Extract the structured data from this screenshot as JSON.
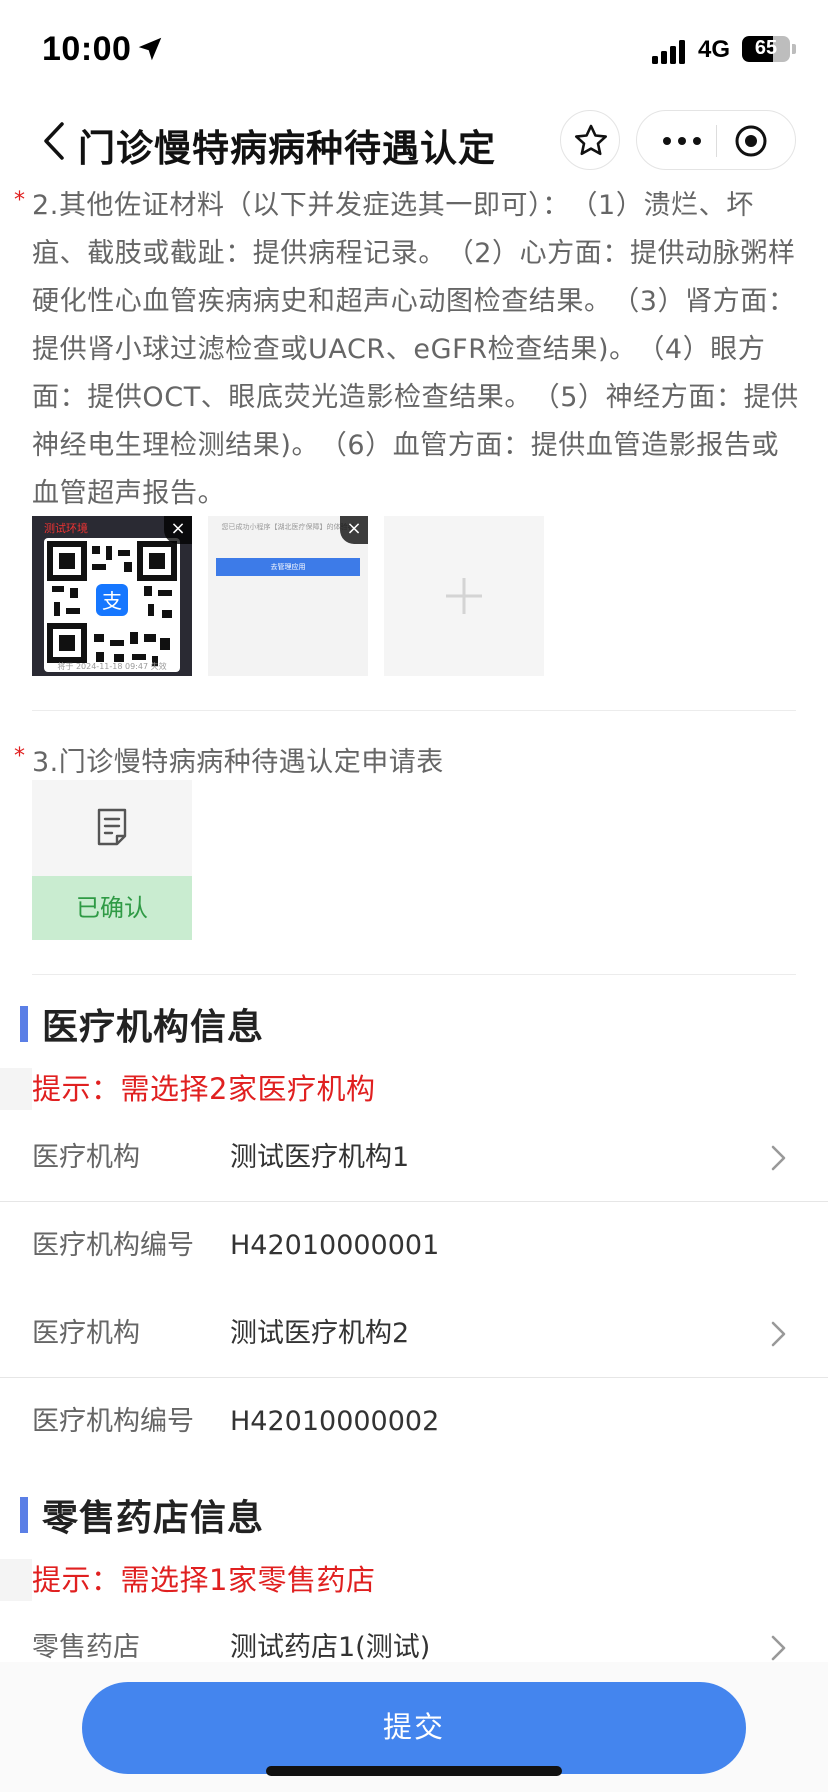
{
  "status": {
    "time": "10:00",
    "network": "4G",
    "battery": "65",
    "battery_level": 0.65
  },
  "nav": {
    "title": "门诊慢特病病种待遇认定",
    "icons": [
      "back-icon",
      "star-icon",
      "more-icon",
      "target-icon"
    ]
  },
  "section2": {
    "required_mark": "*",
    "text": "2.其他佐证材料（以下并发症选其一即可）：　（1）溃烂、坏疽、截肢或截趾：提供病程记录。　（2）心方面：提供动脉粥样硬化性心血管疾病病史和超声心动图检查结果。　（3）肾方面：提供肾小球过滤检查或UACR、eGFR检查结果)。　（4）眼方面：提供OCT、眼底荧光造影检查结果。　（5）神经方面：提供神经电生理检测结果)。　（6）血管方面：提供血管造影报告或血管超声报告。",
    "thumb1_label": "测试环境",
    "thumb1_footer": "将于 2024-11-18 09:47 失效",
    "thumb2_header": "您已成功小程序【湖北医疗保障】的体验者",
    "thumb2_button": "去管理应用",
    "close_glyph": "×"
  },
  "section3": {
    "required_mark": "*",
    "title": "3.门诊慢特病病种待遇认定申请表",
    "status": "已确认"
  },
  "medical": {
    "title": "医疗机构信息",
    "hint": "提示：需选择2家医疗机构",
    "rows": [
      {
        "label": "医疗机构",
        "value": "测试医疗机构1"
      },
      {
        "label": "医疗机构编号",
        "value": "H42010000001"
      },
      {
        "label": "医疗机构",
        "value": "测试医疗机构2"
      },
      {
        "label": "医疗机构编号",
        "value": "H42010000002"
      }
    ]
  },
  "pharmacy": {
    "title": "零售药店信息",
    "hint": "提示：需选择1家零售药店",
    "rows": [
      {
        "label": "零售药店",
        "value": "测试药店1(测试)"
      }
    ]
  },
  "submit_label": "提交",
  "colors": {
    "accent": "#4485ee",
    "section_bar": "#5b7fe6",
    "hint": "#e02020",
    "confirmed_bg": "#c9ecd0",
    "confirmed_text": "#2f9a45"
  }
}
